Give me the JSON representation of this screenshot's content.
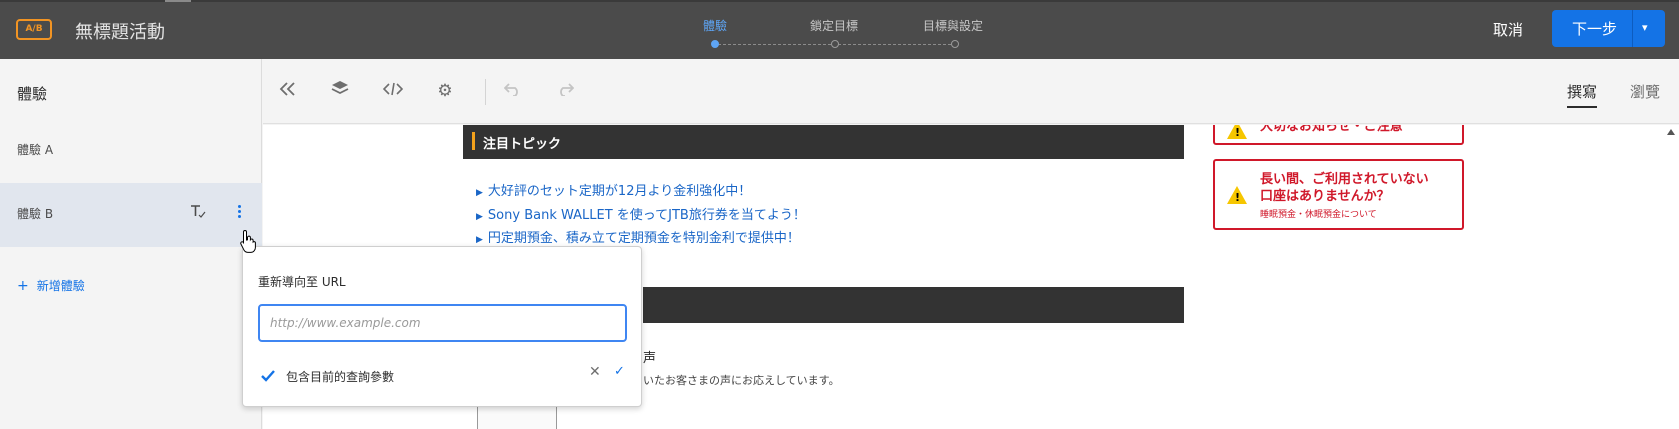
{
  "app": {
    "badge": "A/B",
    "title": "無標題活動"
  },
  "steps": [
    {
      "label": "體驗",
      "active": true
    },
    {
      "label": "鎖定目標",
      "active": false
    },
    {
      "label": "目標與設定",
      "active": false
    }
  ],
  "header_actions": {
    "cancel": "取消",
    "next": "下一步"
  },
  "sidebar": {
    "heading": "體驗",
    "items": [
      {
        "label": "體驗 A",
        "selected": false
      },
      {
        "label": "體驗 B",
        "selected": true
      }
    ],
    "add_label": "新增體驗"
  },
  "toolbar": {
    "icons": [
      "collapse-double-chevron-icon",
      "layers-icon",
      "code-icon",
      "settings-gear-icon",
      "undo-icon",
      "redo-icon"
    ],
    "tabs": [
      {
        "label": "撰寫",
        "active": true
      },
      {
        "label": "瀏覽",
        "active": false
      }
    ]
  },
  "preview": {
    "topic_heading": "注目トピック",
    "topic_links": [
      "大好評のセット定期が12月より金利強化中！",
      "Sony Bank WALLET を使ってJTB旅行券を当てよう！",
      "円定期預金、積み立て定期預金を特別金利で提供中！"
    ],
    "voice_title": "声",
    "voice_text": "いたお客さまの声にお応えしています。",
    "notices": [
      {
        "headline": "大切なお知らせ・ご注意",
        "sub": ""
      },
      {
        "headline": "長い間、ご利用されていない口座はありませんか？",
        "sub": "睡眠預金・休眠預金について"
      }
    ],
    "notice_color": "#d0182a",
    "accent_color": "#f4a21c"
  },
  "redirect_popover": {
    "label": "重新導向至 URL",
    "input_value": "",
    "input_placeholder": "http://www.example.com",
    "checkbox_label": "包含目前的查詢參數",
    "checkbox_checked": true,
    "cancel_symbol": "✕",
    "confirm_symbol": "✓"
  },
  "colors": {
    "topbar": "#4b4b4b",
    "primary": "#1473e6",
    "badge": "#f29423"
  }
}
